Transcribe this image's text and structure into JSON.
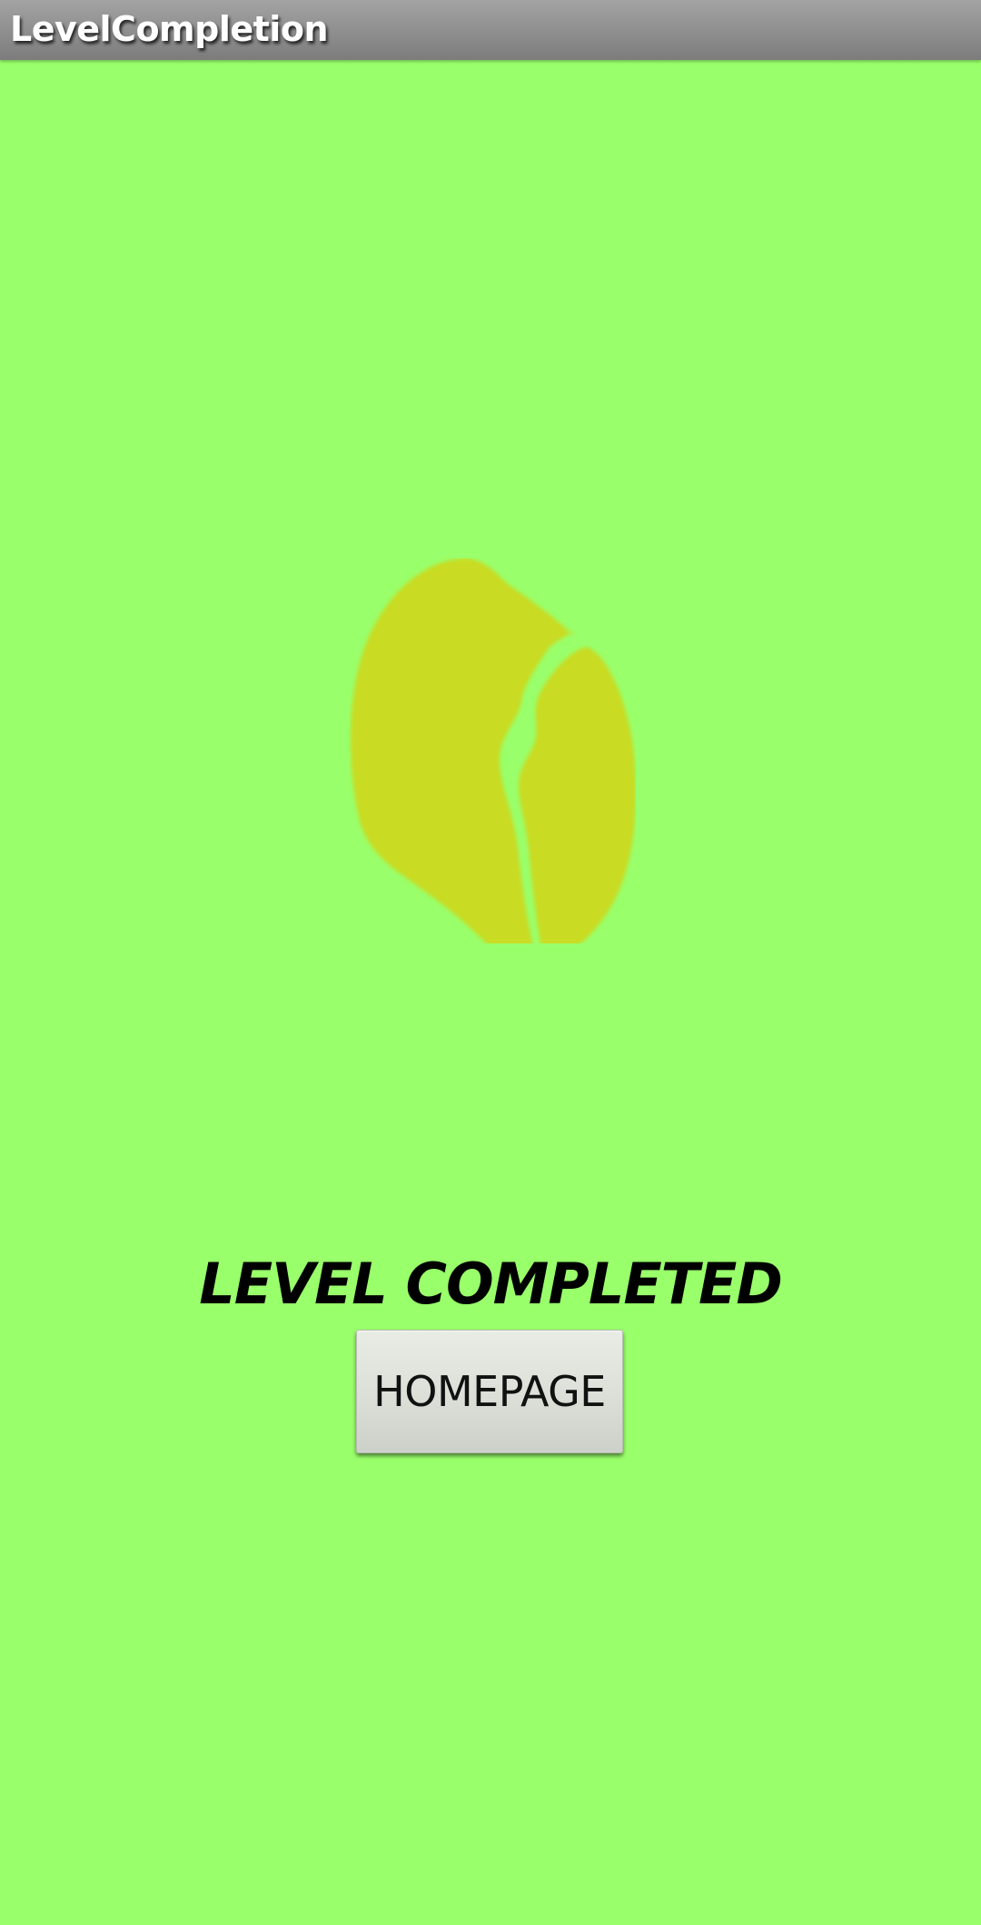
{
  "app": {
    "title": "LevelCompletion"
  },
  "main": {
    "illustration_icon": "seed-icon",
    "message": "LEVEL COMPLETED",
    "home_button_label": "HOMEPAGE"
  },
  "colors": {
    "background": "#99ff6b",
    "title_bar": "#8c8c8c",
    "seed": "#c9db22",
    "text": "#000000",
    "button": "#dcdfd8"
  }
}
